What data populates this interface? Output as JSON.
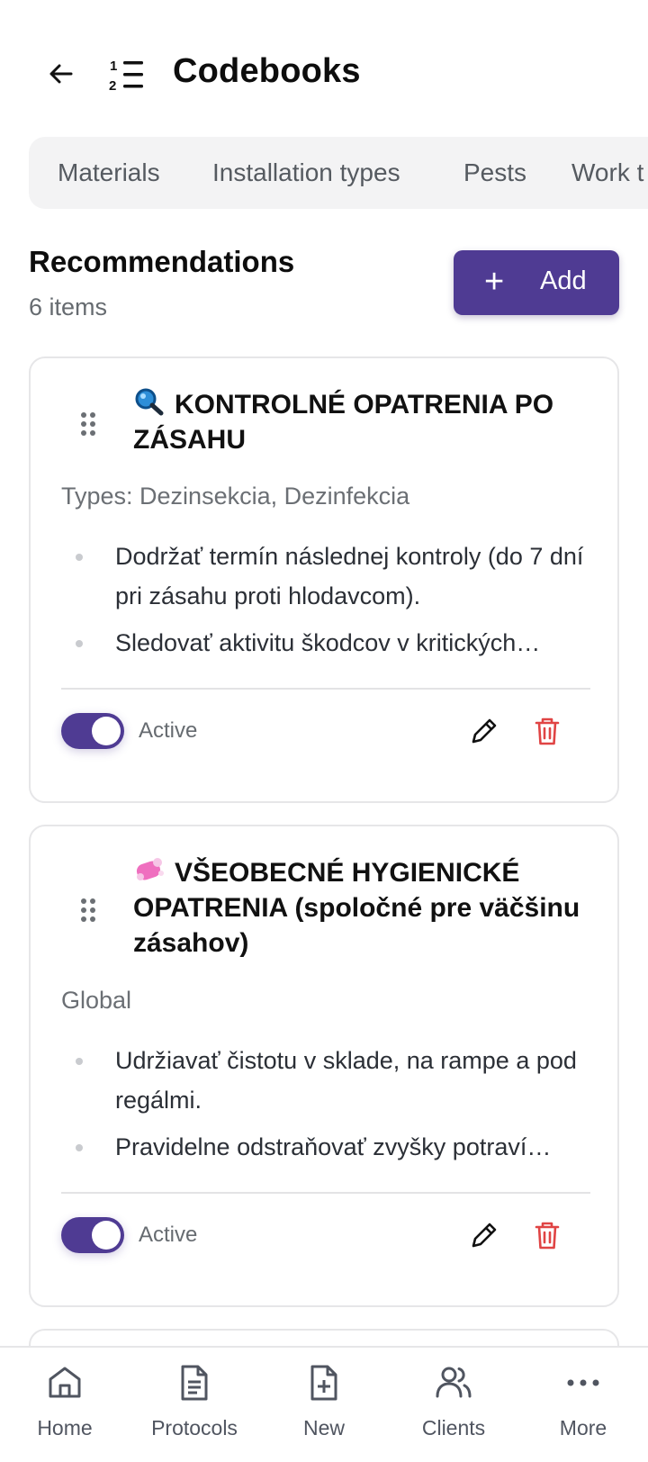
{
  "header": {
    "title": "Codebooks",
    "back_icon": "arrow-left-icon",
    "list_icon": "numbered-list-icon"
  },
  "tabs": [
    {
      "label": "Materials"
    },
    {
      "label": "Installation types"
    },
    {
      "label": "Pests"
    },
    {
      "label": "Work t"
    }
  ],
  "section": {
    "title": "Recommendations",
    "count": "6 items",
    "add_label": "Add",
    "add_icon": "plus-icon"
  },
  "cards": [
    {
      "emoji": "magnifying-glass-icon",
      "title": "KONTROLNÉ OPATRENIA PO ZÁSAHU",
      "types": "Types: Dezinsekcia, Dezinfekcia",
      "bullets": [
        "Dodržať termín následnej kontroly (do 7 dní pri zásahu proti hlodavcom).",
        "Sledovať aktivitu škodcov v kritických…"
      ],
      "active_label": "Active",
      "active": true
    },
    {
      "emoji": "soap-icon",
      "title": "VŠEOBECNÉ HYGIENICKÉ OPATRENIA (spoločné pre väčšinu zásahov)",
      "types": "Global",
      "bullets": [
        "Udržiavať čistotu v sklade, na rampe a pod regálmi.",
        "Pravidelne odstraňovať zvyšky potraví…"
      ],
      "active_label": "Active",
      "active": true
    }
  ],
  "bottom_nav": [
    {
      "label": "Home",
      "icon": "home-icon"
    },
    {
      "label": "Protocols",
      "icon": "document-icon"
    },
    {
      "label": "New",
      "icon": "file-plus-icon"
    },
    {
      "label": "Clients",
      "icon": "users-icon"
    },
    {
      "label": "More",
      "icon": "more-dots-icon"
    }
  ],
  "colors": {
    "accent": "#4f3b93",
    "danger": "#e04444",
    "muted_text": "#6b6f74"
  }
}
